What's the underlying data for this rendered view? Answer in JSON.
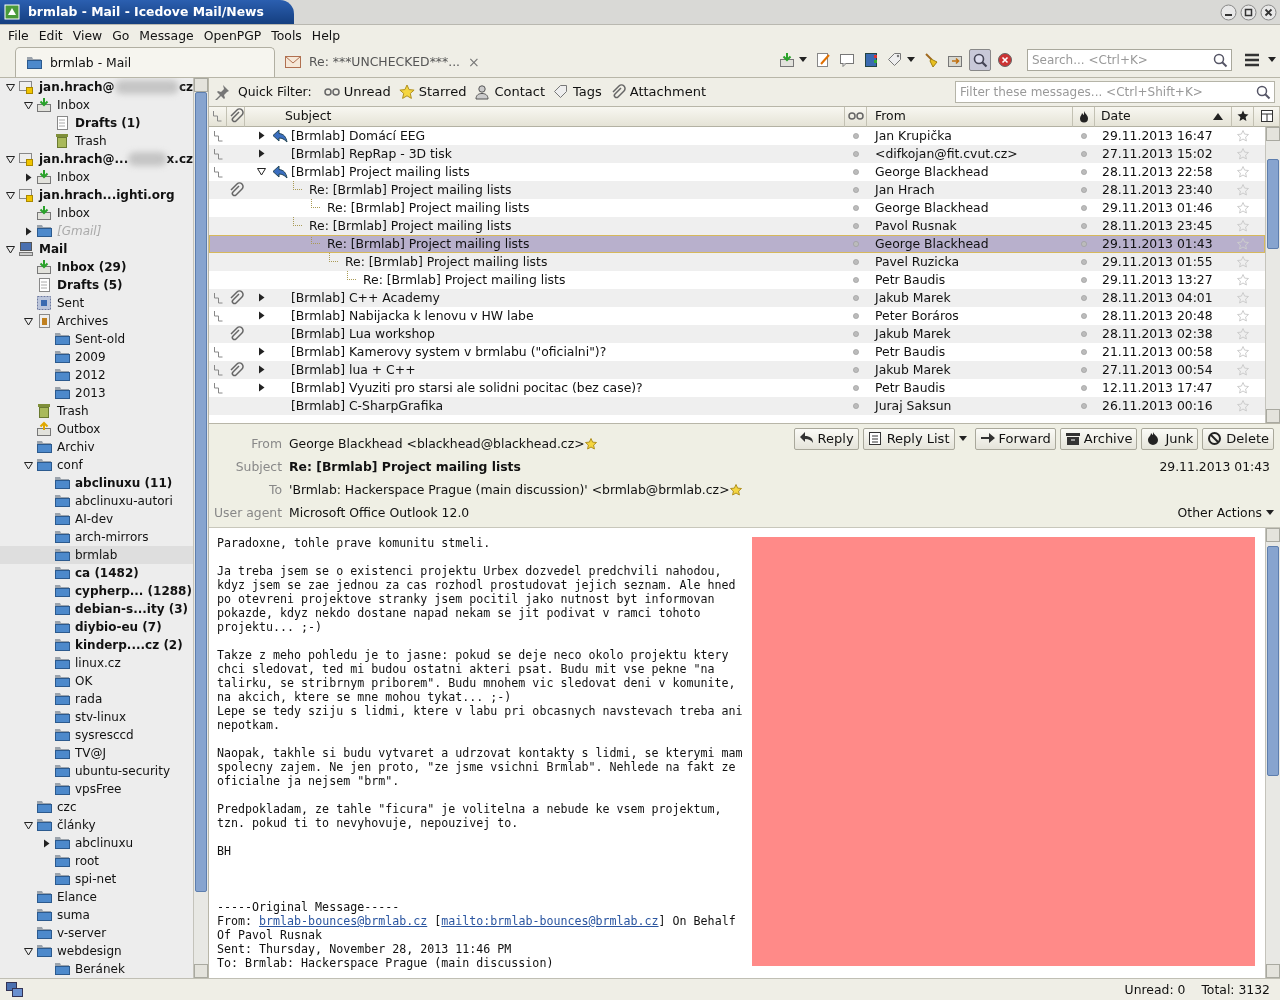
{
  "window": {
    "title": "brmlab - Mail - Icedove Mail/News"
  },
  "menu": [
    "File",
    "Edit",
    "View",
    "Go",
    "Message",
    "OpenPGP",
    "Tools",
    "Help"
  ],
  "tabs": [
    {
      "label": "brmlab - Mail",
      "kind": "folder",
      "selected": true
    },
    {
      "label": "Re: ***UNCHECKED***...",
      "kind": "message",
      "selected": false,
      "close": "×"
    }
  ],
  "search": {
    "placeholder": "Search... <Ctrl+K>"
  },
  "quick_filter": {
    "label": "Quick Filter:",
    "placeholder": "Filter these messages... <Ctrl+Shift+K>",
    "buttons": [
      {
        "label": "Unread",
        "kind": "unread"
      },
      {
        "label": "Starred",
        "kind": "starred"
      },
      {
        "label": "Contact",
        "kind": "contact"
      },
      {
        "label": "Tags",
        "kind": "tags"
      },
      {
        "label": "Attachment",
        "kind": "attachment"
      }
    ]
  },
  "folders": [
    {
      "label": "jan.hrach@",
      "label_end": "cz",
      "kind": "account",
      "expanded": true,
      "children": [
        {
          "label": "Inbox",
          "kind": "inbox",
          "unread": false,
          "expanded": true,
          "children": [
            {
              "label": "Drafts (1)",
              "kind": "drafts",
              "unread": true
            },
            {
              "label": "Trash",
              "kind": "trash",
              "unread": false
            }
          ]
        }
      ]
    },
    {
      "label": "jan.hrach@...",
      "label_end": "x.cz",
      "kind": "account",
      "expanded": true,
      "children": [
        {
          "label": "Inbox",
          "kind": "inbox",
          "unread": false,
          "expanded": false
        }
      ]
    },
    {
      "label": "jan.hrach...ighti.org",
      "kind": "account",
      "expanded": true,
      "children": [
        {
          "label": "Inbox",
          "kind": "inbox",
          "unread": false
        },
        {
          "label": "[Gmail]",
          "kind": "folder",
          "unread": false,
          "greyed": true,
          "expanded": false
        }
      ]
    },
    {
      "label": "Mail",
      "kind": "local",
      "expanded": true,
      "children": [
        {
          "label": "Inbox (29)",
          "kind": "inbox",
          "unread": true
        },
        {
          "label": "Drafts (5)",
          "kind": "drafts",
          "unread": true
        },
        {
          "label": "Sent",
          "kind": "sent",
          "unread": false
        },
        {
          "label": "Archives",
          "kind": "archives",
          "unread": false,
          "expanded": true,
          "children": [
            {
              "label": "Sent-old",
              "kind": "folder",
              "unread": false
            },
            {
              "label": "2009",
              "kind": "folder",
              "unread": false
            },
            {
              "label": "2012",
              "kind": "folder",
              "unread": false
            },
            {
              "label": "2013",
              "kind": "folder",
              "unread": false
            }
          ]
        },
        {
          "label": "Trash",
          "kind": "trash",
          "unread": false
        },
        {
          "label": "Outbox",
          "kind": "outbox",
          "unread": false
        },
        {
          "label": "Archiv",
          "kind": "folder",
          "unread": false
        },
        {
          "label": "conf",
          "kind": "folder",
          "unread": false,
          "expanded": true,
          "children": [
            {
              "label": "abclinuxu (11)",
              "kind": "folder",
              "unread": true
            },
            {
              "label": "abclinuxu-autori",
              "kind": "folder",
              "unread": false
            },
            {
              "label": "AI-dev",
              "kind": "folder",
              "unread": false
            },
            {
              "label": "arch-mirrors",
              "kind": "folder",
              "unread": false
            },
            {
              "label": "brmlab",
              "kind": "folder",
              "unread": false,
              "selected": true
            },
            {
              "label": "ca (1482)",
              "kind": "folder",
              "unread": true
            },
            {
              "label": "cypherp... (1288)",
              "kind": "folder",
              "unread": true
            },
            {
              "label": "debian-s...ity (3)",
              "kind": "folder",
              "unread": true
            },
            {
              "label": "diybio-eu (7)",
              "kind": "folder",
              "unread": true
            },
            {
              "label": "kinderp....cz (2)",
              "kind": "folder",
              "unread": true
            },
            {
              "label": "linux.cz",
              "kind": "folder",
              "unread": false
            },
            {
              "label": "OK",
              "kind": "folder",
              "unread": false
            },
            {
              "label": "rada",
              "kind": "folder",
              "unread": false
            },
            {
              "label": "stv-linux",
              "kind": "folder",
              "unread": false
            },
            {
              "label": "sysresccd",
              "kind": "folder",
              "unread": false
            },
            {
              "label": "TV@J",
              "kind": "folder",
              "unread": false
            },
            {
              "label": "ubuntu-security",
              "kind": "folder",
              "unread": false
            },
            {
              "label": "vpsFree",
              "kind": "folder",
              "unread": false
            }
          ]
        },
        {
          "label": "czc",
          "kind": "folder",
          "unread": false
        },
        {
          "label": "články",
          "kind": "folder",
          "unread": false,
          "expanded": true,
          "children": [
            {
              "label": "abclinuxu",
              "kind": "folder",
              "unread": false,
              "expanded": false
            },
            {
              "label": "root",
              "kind": "folder",
              "unread": false
            },
            {
              "label": "spi-net",
              "kind": "folder",
              "unread": false
            }
          ]
        },
        {
          "label": "Elance",
          "kind": "folder",
          "unread": false
        },
        {
          "label": "suma",
          "kind": "folder",
          "unread": false
        },
        {
          "label": "v-server",
          "kind": "folder",
          "unread": false
        },
        {
          "label": "webdesign",
          "kind": "folder",
          "unread": false,
          "expanded": true,
          "children": [
            {
              "label": "Beránek",
              "kind": "folder",
              "unread": false
            }
          ]
        }
      ]
    }
  ],
  "message_list": {
    "columns": {
      "subject": "Subject",
      "from": "From",
      "date": "Date"
    },
    "rows": [
      {
        "subject": "[Brmlab] Domácí EEG",
        "from": "Jan Krupička",
        "date": "29.11.2013 16:47",
        "attachment": false,
        "replied": true,
        "expanded": false,
        "selected": false
      },
      {
        "subject": "[Brmlab] RepRap - 3D tisk",
        "from": "<difkojan@fit.cvut.cz>",
        "date": "27.11.2013 15:02",
        "attachment": false,
        "replied": false,
        "expanded": false,
        "selected": false
      },
      {
        "subject": "[Brmlab] Project mailing lists",
        "from": "George Blackhead",
        "date": "28.11.2013 22:58",
        "attachment": false,
        "replied": true,
        "expanded": true,
        "selected": false,
        "children": [
          {
            "subject": "Re: [Brmlab] Project mailing lists",
            "from": "Jan Hrach",
            "date": "28.11.2013 23:40",
            "attachment": true,
            "replied": false,
            "selected": false,
            "children": [
              {
                "subject": "Re: [Brmlab] Project mailing lists",
                "from": "George Blackhead",
                "date": "29.11.2013 01:46",
                "attachment": false,
                "replied": false,
                "selected": false
              }
            ]
          },
          {
            "subject": "Re: [Brmlab] Project mailing lists",
            "from": "Pavol Rusnak",
            "date": "28.11.2013 23:45",
            "attachment": false,
            "replied": false,
            "selected": false,
            "children": [
              {
                "subject": "Re: [Brmlab] Project mailing lists",
                "from": "George Blackhead",
                "date": "29.11.2013 01:43",
                "attachment": false,
                "replied": false,
                "selected": true,
                "children": [
                  {
                    "subject": "Re: [Brmlab] Project mailing lists",
                    "from": "Pavel Ruzicka",
                    "date": "29.11.2013 01:55",
                    "attachment": false,
                    "replied": false,
                    "selected": false,
                    "children": [
                      {
                        "subject": "Re: [Brmlab] Project mailing lists",
                        "from": "Petr Baudis",
                        "date": "29.11.2013 13:27",
                        "attachment": false,
                        "replied": false,
                        "selected": false
                      }
                    ]
                  }
                ]
              }
            ]
          }
        ]
      },
      {
        "subject": "[Brmlab] C++ Academy",
        "from": "Jakub Marek",
        "date": "28.11.2013 04:01",
        "attachment": true,
        "replied": false,
        "expanded": false,
        "selected": false
      },
      {
        "subject": "[Brmlab] Nabijacka k lenovu v HW labe",
        "from": "Peter Boráros",
        "date": "28.11.2013 20:48",
        "attachment": false,
        "replied": false,
        "expanded": false,
        "selected": false
      },
      {
        "subject": "[Brmlab] Lua workshop",
        "from": "Jakub Marek",
        "date": "28.11.2013 02:38",
        "attachment": true,
        "replied": false,
        "selected": false
      },
      {
        "subject": "[Brmlab] Kamerovy system v brmlabu (\"oficialni\")?",
        "from": "Petr Baudis",
        "date": "21.11.2013 00:58",
        "attachment": false,
        "replied": false,
        "expanded": false,
        "selected": false
      },
      {
        "subject": "[Brmlab] lua + C++",
        "from": "Jakub Marek",
        "date": "27.11.2013 00:54",
        "attachment": true,
        "replied": false,
        "expanded": false,
        "selected": false
      },
      {
        "subject": "[Brmlab] Vyuziti pro starsi ale solidni pocitac (bez case)?",
        "from": "Petr Baudis",
        "date": "12.11.2013 17:47",
        "attachment": false,
        "replied": false,
        "expanded": false,
        "selected": false
      },
      {
        "subject": "[Brmlab] C-SharpGrafika",
        "from": "Juraj Saksun",
        "date": "26.11.2013 00:16",
        "attachment": false,
        "replied": false,
        "selected": false
      }
    ]
  },
  "message": {
    "fields": [
      {
        "label": "From",
        "value": "George Blackhead <blackhead@blackhead.cz>",
        "in_address_book": true
      },
      {
        "label": "Subject",
        "value": "Re: [Brmlab] Project mailing lists",
        "kind": "subject"
      },
      {
        "label": "To",
        "value": "'Brmlab: Hackerspace Prague (main discussion)' <brmlab@brmlab.cz>",
        "in_address_book": true
      },
      {
        "label": "User agent",
        "value": "Microsoft Office Outlook 12.0"
      }
    ],
    "date": "29.11.2013 01:43",
    "actions": [
      {
        "label": "Reply",
        "kind": "reply"
      },
      {
        "label": "Reply List",
        "kind": "reply-list",
        "menu": true
      },
      {
        "label": "Forward",
        "kind": "forward"
      },
      {
        "label": "Archive",
        "kind": "archive"
      },
      {
        "label": "Junk",
        "kind": "junk"
      },
      {
        "label": "Delete",
        "kind": "delete"
      }
    ],
    "other_actions": "Other Actions",
    "body": [
      "Paradoxne, tohle prave komunitu stmeli.",
      "Ja treba jsem se o existenci projektu Urbex dozvedel predchvili nahodou,\nkdyz jsem se zae jednou za cas rozhodl prostudovat jejich seznam. Ale hned\npo otevreni projektove stranky jsem pocitil jako nutnost byt informovan\npokazde, kdyz nekdo dostane napad nekam se jit podivat v ramci tohoto\nprojektu... ;-)",
      "Takze z meho pohledu je to jasne: pokud se deje neco okolo projektu ktery\nchci sledovat, ted mi budou ostatni akteri psat. Budu mit vse pekne \"na\ntalirku, se stribrnym priborem\". Budu mnohem vic sledovat deni v komunite,\nna akcich, ktere se mne mohou tykat... ;-)\nLepe se tedy sziju s lidmi, ktere v labu pri obcasnych navstevach treba ani\nnepotkam.",
      "Naopak, takhle si budu vytvaret a udrzovat kontakty s lidmi, se kterymi mam\nspolecny zajem. Ne jen proto, \"ze jsme vsichni Brmlab\". Nehlede na fakt ze\noficialne ja nejsem \"brm\".",
      "Predpokladam, ze tahle \"ficura\" je volitelna a nebude ke vsem projektum,\ntzn. pokud ti to nevyhovuje, nepouzivej to.",
      "BH"
    ],
    "original": {
      "heading": "-----Original Message-----",
      "from_parts": [
        {
          "text": "From: "
        },
        {
          "link": "brmlab-bounces@brmlab.cz"
        },
        {
          "text": " ["
        },
        {
          "link": "mailto:brmlab-bounces@brmlab.cz"
        },
        {
          "text": "] On Behalf\nOf Pavol Rusnak"
        }
      ],
      "lines": [
        "Sent: Thursday, November 28, 2013 11:46 PM",
        "To: Brmlab: Hackerspace Prague (main discussion)"
      ]
    }
  },
  "status_bar": {
    "unread": "Unread: 0",
    "total": "Total: 3132"
  }
}
